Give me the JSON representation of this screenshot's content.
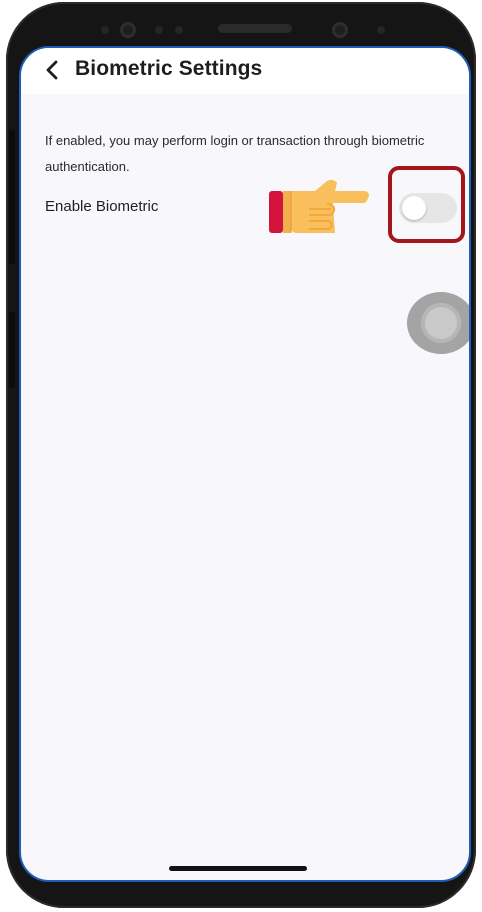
{
  "header": {
    "title": "Biometric Settings",
    "back_icon": "chevron-left-icon"
  },
  "content": {
    "description": "If enabled, you may perform login or transaction through biometric authentication.",
    "setting_label": "Enable Biometric",
    "toggle_state": "off"
  },
  "overlay": {
    "hand_icon": "pointing-hand-icon",
    "highlight_color": "#a3161c",
    "assistive_touch_icon": "assistive-touch-icon"
  },
  "colors": {
    "screen_border": "#1c5fb7",
    "background": "#f8f7fb",
    "header_background": "#ffffff",
    "toggle_off": "#e6e6e6"
  }
}
